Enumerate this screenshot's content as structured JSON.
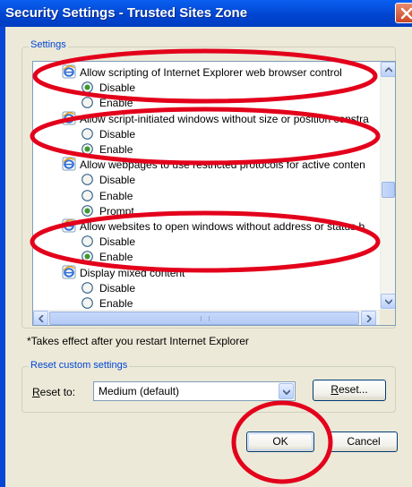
{
  "window": {
    "title": "Security Settings - Trusted Sites Zone"
  },
  "settings_group": {
    "legend": "Settings",
    "items": [
      {
        "type": "header",
        "icon": "ie-icon",
        "label": "Allow scripting of Internet Explorer web browser control"
      },
      {
        "type": "option",
        "label": "Disable",
        "checked": true
      },
      {
        "type": "option",
        "label": "Enable",
        "checked": false
      },
      {
        "type": "header",
        "icon": "ie-icon",
        "label": "Allow script-initiated windows without size or position constra"
      },
      {
        "type": "option",
        "label": "Disable",
        "checked": false
      },
      {
        "type": "option",
        "label": "Enable",
        "checked": true
      },
      {
        "type": "header",
        "icon": "ie-icon",
        "label": "Allow webpages to use restricted protocols for active conten"
      },
      {
        "type": "option",
        "label": "Disable",
        "checked": false
      },
      {
        "type": "option",
        "label": "Enable",
        "checked": false
      },
      {
        "type": "option",
        "label": "Prompt",
        "checked": true
      },
      {
        "type": "header",
        "icon": "ie-icon",
        "label": "Allow websites to open windows without address or status b"
      },
      {
        "type": "option",
        "label": "Disable",
        "checked": false
      },
      {
        "type": "option",
        "label": "Enable",
        "checked": true
      },
      {
        "type": "header",
        "icon": "ie-icon",
        "label": "Display mixed content"
      },
      {
        "type": "option",
        "label": "Disable",
        "checked": false
      },
      {
        "type": "option",
        "label": "Enable",
        "checked": false
      }
    ]
  },
  "note": "*Takes effect after you restart Internet Explorer",
  "reset_group": {
    "legend": "Reset custom settings",
    "reset_to_label_first": "R",
    "reset_to_label_rest": "eset to:",
    "selected": "Medium (default)",
    "reset_button_first": "R",
    "reset_button_rest": "eset..."
  },
  "footer": {
    "ok_label": "OK",
    "cancel_label": "Cancel"
  },
  "colors": {
    "title_bar": "#0045d0",
    "legend": "#0046d5",
    "annotation": "#e3001b",
    "dialog_bg": "#ece9d8"
  }
}
